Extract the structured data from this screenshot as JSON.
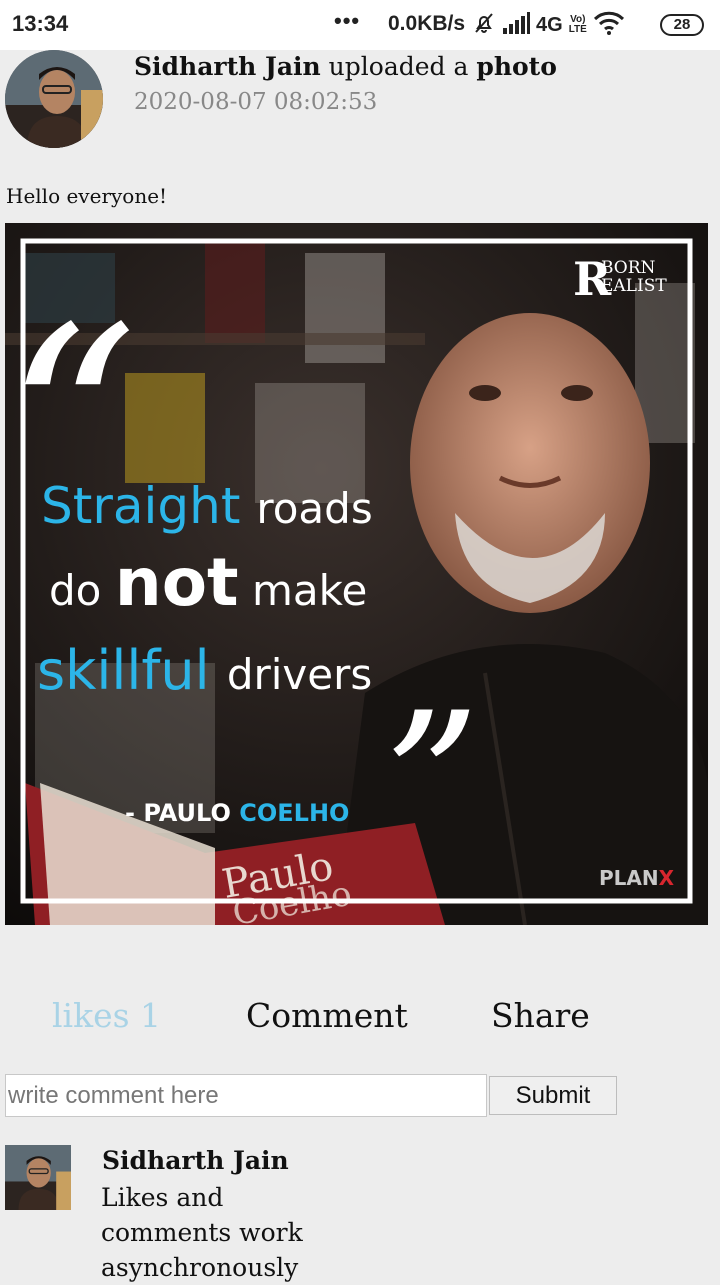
{
  "status_bar": {
    "time": "13:34",
    "dots": "•••",
    "net_speed": "0.0KB/s",
    "network_type": "4G",
    "volte_top": "Vo)",
    "volte_bottom": "LTE",
    "battery": "28",
    "icons": [
      "mute-icon",
      "signal-icon",
      "wifi-icon",
      "battery-icon"
    ]
  },
  "post": {
    "author": "Sidharth Jain",
    "action_text": "uploaded a",
    "object": "photo",
    "timestamp": "2020-08-07 08:02:53",
    "caption": "Hello everyone!",
    "image": {
      "brand": "BORN REALIST",
      "brand_letter": "R",
      "brand_line1": "BORN",
      "brand_line2": "EALIST",
      "open_quote": "“",
      "close_quote": "”",
      "quote_line1_a": "Straight",
      "quote_line1_b": "roads",
      "quote_line2_a": "do",
      "quote_line2_b": "not",
      "quote_line2_c": "make",
      "quote_line3_a": "skillful",
      "quote_line3_b": "drivers",
      "attribution_a": "- PAULO",
      "attribution_b": "COELHO",
      "watermark_a": "PLAN",
      "watermark_b": "X",
      "book_author": "Paulo",
      "book_title": "Coelho",
      "accent_color": "#2cb5e8"
    }
  },
  "actions": {
    "likes_label": "likes 1",
    "comment_label": "Comment",
    "share_label": "Share"
  },
  "comment_form": {
    "placeholder": "write comment here",
    "value": "",
    "submit_label": "Submit"
  },
  "comments": [
    {
      "author": "Sidharth Jain",
      "text": "Likes and comments work asynchronously"
    }
  ]
}
